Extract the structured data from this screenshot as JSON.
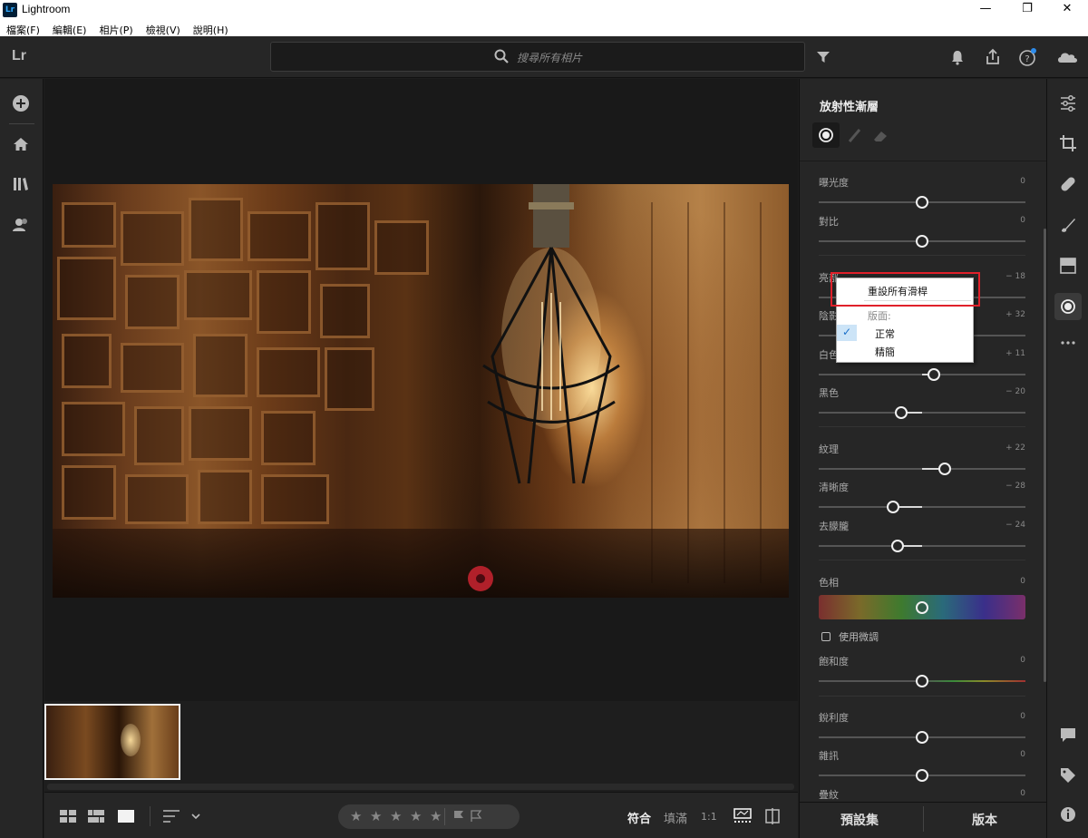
{
  "window": {
    "app_icon_text": "Lr",
    "title": "Lightroom",
    "minimize": "—",
    "maximize": "❐",
    "close": "✕"
  },
  "menu": [
    "檔案(F)",
    "編輯(E)",
    "相片(P)",
    "檢視(V)",
    "說明(H)"
  ],
  "toolbar": {
    "logo": "Lr",
    "search_placeholder": "搜尋所有相片"
  },
  "panel": {
    "title": "放射性漸層",
    "sliders": [
      {
        "label": "曝光度",
        "value": "0",
        "pos": 0.5
      },
      {
        "label": "對比",
        "value": "0",
        "pos": 0.5
      },
      {
        "label": "亮部",
        "value": "− 18",
        "pos": 0.41
      },
      {
        "label": "陰影",
        "value": "+ 32",
        "pos": 0.66
      },
      {
        "label": "白色",
        "value": "+ 11",
        "pos": 0.555
      },
      {
        "label": "黑色",
        "value": "− 20",
        "pos": 0.4
      },
      {
        "label": "紋理",
        "value": "+ 22",
        "pos": 0.61
      },
      {
        "label": "清晰度",
        "value": "− 28",
        "pos": 0.36
      },
      {
        "label": "去朦朧",
        "value": "− 24",
        "pos": 0.38
      },
      {
        "label": "色相",
        "value": "0",
        "pos": 0.5
      },
      {
        "label": "飽和度",
        "value": "0",
        "pos": 0.5
      },
      {
        "label": "銳利度",
        "value": "0",
        "pos": 0.5
      },
      {
        "label": "雜訊",
        "value": "0",
        "pos": 0.5
      },
      {
        "label": "疊紋",
        "value": "0",
        "pos": 0.5
      }
    ],
    "fine_tune_label": "使用微調",
    "presets_label": "預設集",
    "versions_label": "版本"
  },
  "bottom": {
    "fit_label": "符合",
    "fill_label": "填滿",
    "ratio_label": "1:1",
    "stars": [
      "★",
      "★",
      "★",
      "★",
      "★"
    ]
  },
  "context_menu": {
    "reset_all": "重設所有滑桿",
    "layout_label": "版面:",
    "normal": "正常",
    "compact": "精簡",
    "checkmark": "✓"
  }
}
